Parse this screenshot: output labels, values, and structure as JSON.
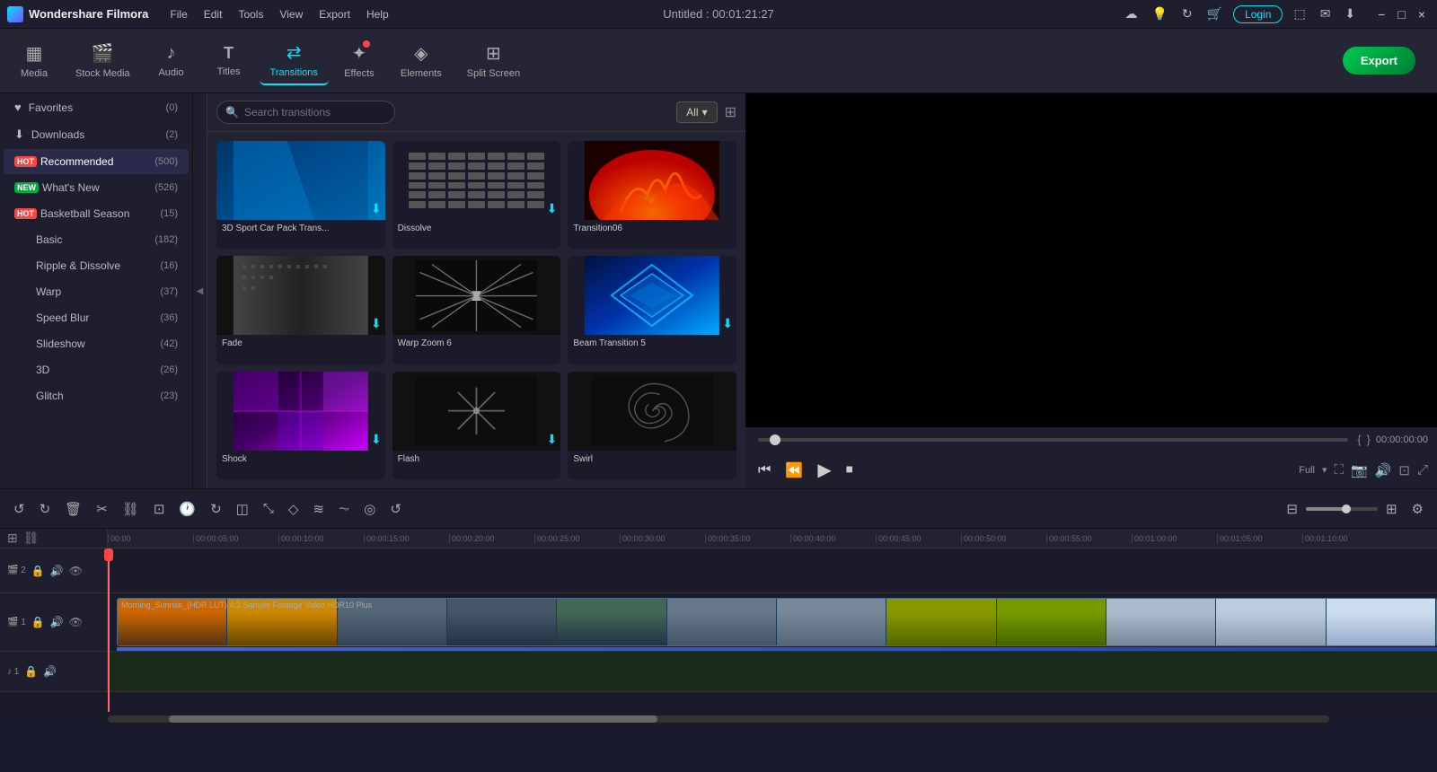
{
  "app": {
    "name": "Wondershare Filmora",
    "logo": "F",
    "title": "Untitled : 00:01:21:27"
  },
  "menu": [
    "File",
    "Edit",
    "Tools",
    "View",
    "Export",
    "Help"
  ],
  "toolbar": {
    "items": [
      {
        "id": "media",
        "label": "Media",
        "icon": "▦"
      },
      {
        "id": "stock",
        "label": "Stock Media",
        "icon": "🎬",
        "dot": false
      },
      {
        "id": "audio",
        "label": "Audio",
        "icon": "♪"
      },
      {
        "id": "titles",
        "label": "Titles",
        "icon": "T"
      },
      {
        "id": "transitions",
        "label": "Transitions",
        "icon": "⇄",
        "active": true
      },
      {
        "id": "effects",
        "label": "Effects",
        "icon": "✦",
        "dot": true
      },
      {
        "id": "elements",
        "label": "Elements",
        "icon": "◈"
      },
      {
        "id": "splitscreen",
        "label": "Split Screen",
        "icon": "⊞"
      }
    ],
    "export_label": "Export"
  },
  "sidebar": {
    "items": [
      {
        "id": "favorites",
        "label": "Favorites",
        "icon": "♥",
        "count": "(0)",
        "badge": ""
      },
      {
        "id": "downloads",
        "label": "Downloads",
        "icon": "⬇",
        "count": "(2)",
        "badge": ""
      },
      {
        "id": "recommended",
        "label": "Recommended",
        "icon": "",
        "count": "(500)",
        "badge": "hot",
        "active": true
      },
      {
        "id": "whats-new",
        "label": "What's New",
        "icon": "",
        "count": "(526)",
        "badge": "new"
      },
      {
        "id": "basketball",
        "label": "Basketball Season",
        "icon": "",
        "count": "(15)",
        "badge": "hot"
      },
      {
        "id": "basic",
        "label": "Basic",
        "icon": "",
        "count": "(182)",
        "badge": ""
      },
      {
        "id": "ripple",
        "label": "Ripple & Dissolve",
        "icon": "",
        "count": "(16)",
        "badge": ""
      },
      {
        "id": "warp",
        "label": "Warp",
        "icon": "",
        "count": "(37)",
        "badge": ""
      },
      {
        "id": "speedblur",
        "label": "Speed Blur",
        "icon": "",
        "count": "(36)",
        "badge": ""
      },
      {
        "id": "slideshow",
        "label": "Slideshow",
        "icon": "",
        "count": "(42)",
        "badge": ""
      },
      {
        "id": "3d",
        "label": "3D",
        "icon": "",
        "count": "(26)",
        "badge": ""
      },
      {
        "id": "glitch",
        "label": "Glitch",
        "icon": "",
        "count": "(23)",
        "badge": ""
      }
    ]
  },
  "search": {
    "placeholder": "Search transitions"
  },
  "filter": {
    "label": "All"
  },
  "transitions": [
    {
      "id": "t1",
      "label": "3D Sport Car Pack Trans...",
      "type": "sport",
      "has_dl": true
    },
    {
      "id": "t2",
      "label": "Dissolve",
      "type": "dissolve",
      "has_dl": true
    },
    {
      "id": "t3",
      "label": "Transition06",
      "type": "fire",
      "has_dl": false
    },
    {
      "id": "t4",
      "label": "Fade",
      "type": "fade",
      "has_dl": true
    },
    {
      "id": "t5",
      "label": "Warp Zoom 6",
      "type": "warpzoom",
      "has_dl": false
    },
    {
      "id": "t6",
      "label": "Beam Transition 5",
      "type": "beam",
      "has_dl": true
    },
    {
      "id": "t7",
      "label": "Shock",
      "type": "shock",
      "has_dl": true
    },
    {
      "id": "t8",
      "label": "Flash",
      "type": "flash",
      "has_dl": true
    },
    {
      "id": "t9",
      "label": "Swirl",
      "type": "swirl",
      "has_dl": false
    }
  ],
  "preview": {
    "timecode": "00:00:00:00",
    "quality": "Full"
  },
  "timeline": {
    "ruler_marks": [
      "00:00",
      "00:00:05:00",
      "00:00:10:00",
      "00:00:15:00",
      "00:00:20:00",
      "00:00:25:00",
      "00:00:30:00",
      "00:00:35:00",
      "00:00:40:00",
      "00:00:45:00",
      "00:00:50:00",
      "00:00:55:00",
      "00:01:00:00",
      "00:01:05:00",
      "00:01:10:00"
    ],
    "clip_label": "Morning_Sunrise_(HDR LUT) 4:3 Sample Footage Video HDR10 Plus",
    "tracks": [
      {
        "id": "v2",
        "num": "2",
        "type": "video"
      },
      {
        "id": "v1",
        "num": "1",
        "type": "video_main"
      },
      {
        "id": "a1",
        "num": "1",
        "type": "audio"
      }
    ]
  },
  "window_controls": {
    "minimize": "−",
    "maximize": "□",
    "close": "×"
  }
}
